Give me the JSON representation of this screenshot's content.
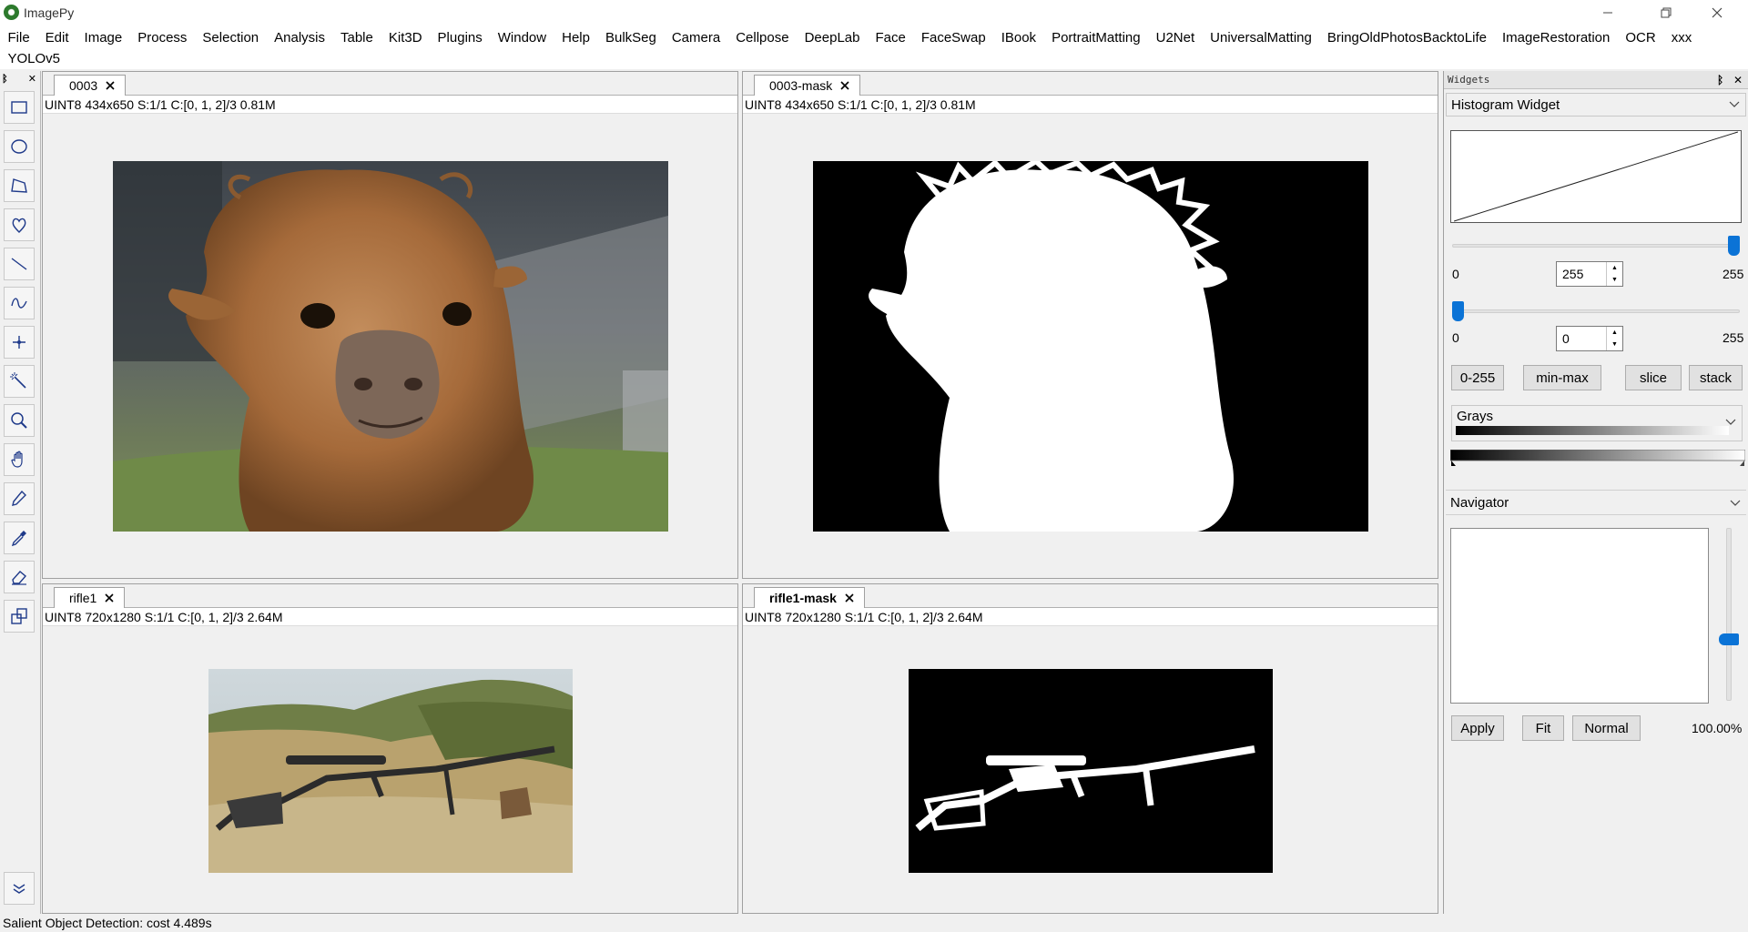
{
  "app": {
    "title": "ImagePy"
  },
  "menu": {
    "row1": [
      "File",
      "Edit",
      "Image",
      "Process",
      "Selection",
      "Analysis",
      "Table",
      "Kit3D",
      "Plugins",
      "Window",
      "Help",
      "BulkSeg",
      "Camera",
      "Cellpose",
      "DeepLab",
      "Face",
      "FaceSwap",
      "IBook",
      "PortraitMatting",
      "U2Net",
      "UniversalMatting",
      "BringOldPhotosBacktoLife",
      "ImageRestoration",
      "OCR",
      "xxx"
    ],
    "row2": [
      "YOLOv5"
    ]
  },
  "toolbar": {
    "tools": [
      "rectangle-select",
      "ellipse-select",
      "polygon-select",
      "freehand-select",
      "line",
      "curve",
      "point",
      "magic-wand",
      "zoom",
      "hand-pan",
      "pencil",
      "color-picker",
      "eraser",
      "clone"
    ],
    "more": "expand-more"
  },
  "panels": [
    {
      "tab": "0003",
      "info": "UINT8  434x650  S:1/1  C:[0, 1, 2]/3  0.81M",
      "image": "alpaca-photo"
    },
    {
      "tab": "0003-mask",
      "info": "UINT8  434x650  S:1/1  C:[0, 1, 2]/3  0.81M",
      "image": "alpaca-mask"
    },
    {
      "tab": "rifle1",
      "info": "UINT8  720x1280  S:1/1  C:[0, 1, 2]/3  2.64M",
      "image": "rifle-photo"
    },
    {
      "tab": "rifle1-mask",
      "info": "UINT8  720x1280  S:1/1  C:[0, 1, 2]/3  2.64M",
      "image": "rifle-mask"
    }
  ],
  "widgets": {
    "title": "Widgets",
    "histogram": {
      "title": "Histogram Widget",
      "max_slider": {
        "min": "0",
        "value": "255",
        "max": "255",
        "position": 1.0
      },
      "min_slider": {
        "min": "0",
        "value": "0",
        "max": "255",
        "position": 0.0
      },
      "buttons": [
        "0-255",
        "min-max",
        "slice",
        "stack"
      ],
      "lut": "Grays"
    },
    "navigator": {
      "title": "Navigator",
      "buttons": [
        "Apply",
        "Fit",
        "Normal"
      ],
      "zoom": "100.00%"
    }
  },
  "status": {
    "text": "Salient Object Detection: cost 4.489s"
  },
  "colors": {
    "accent": "#0b73d6",
    "tool_icon": "#1f3a8a"
  }
}
